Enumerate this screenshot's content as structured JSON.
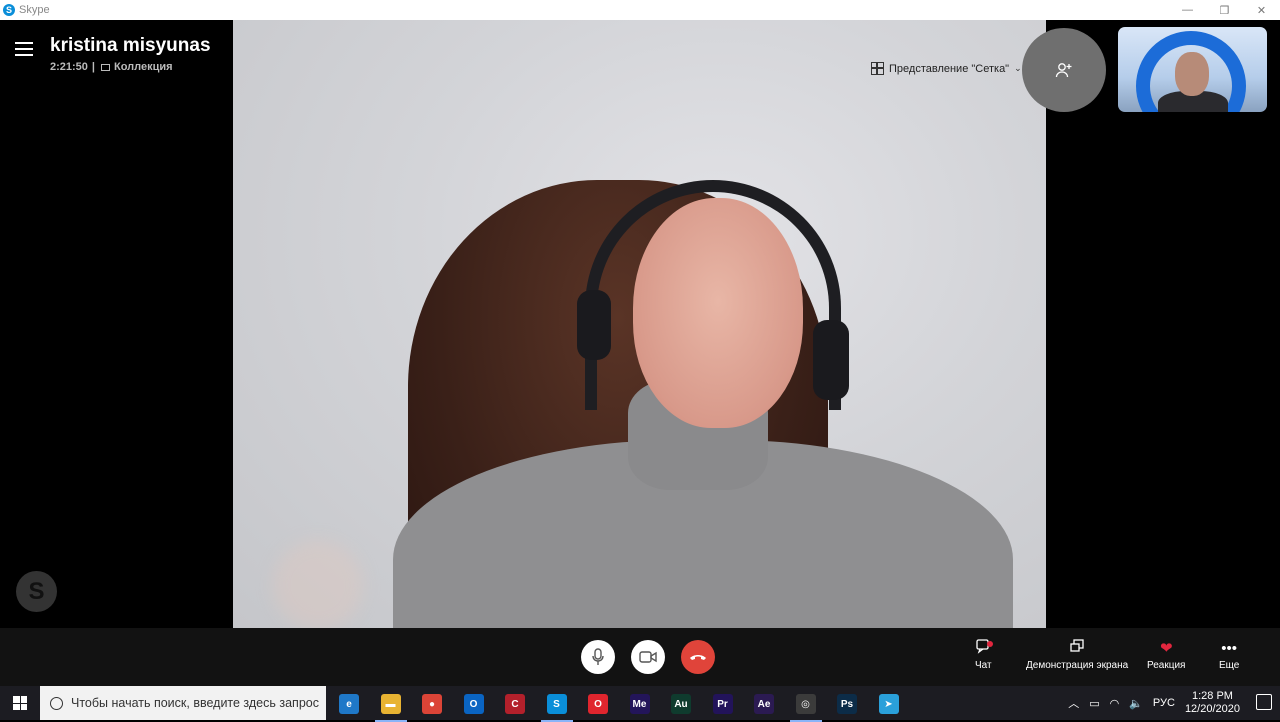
{
  "window": {
    "title": "Skype",
    "minimize": "—",
    "restore": "❐",
    "close": "✕"
  },
  "call": {
    "contact_name": "kristina misyunas",
    "duration": "2:21:50",
    "separator": "|",
    "gallery_label": "Коллекция",
    "view_label": "Представление \"Сетка\"",
    "add_people_icon": "add-person-icon"
  },
  "controls": {
    "chat_label": "Чат",
    "share_label": "Демонстрация экрана",
    "reaction_label": "Реакция",
    "more_label": "Еще"
  },
  "taskbar": {
    "search_placeholder": "Чтобы начать поиск, введите здесь запрос",
    "apps": [
      {
        "name": "edge",
        "label": "e",
        "color": "#1f78c8"
      },
      {
        "name": "file-explorer",
        "label": "▬",
        "color": "#e8b332"
      },
      {
        "name": "chrome",
        "label": "●",
        "color": "#db4437"
      },
      {
        "name": "outlook",
        "label": "O",
        "color": "#0a64c2"
      },
      {
        "name": "app-red",
        "label": "C",
        "color": "#b3202b"
      },
      {
        "name": "skype",
        "label": "S",
        "color": "#0a8ed9"
      },
      {
        "name": "opera",
        "label": "O",
        "color": "#e0252e"
      },
      {
        "name": "media-encoder",
        "label": "Me",
        "color": "#23155a"
      },
      {
        "name": "audition",
        "label": "Au",
        "color": "#0f3b2e"
      },
      {
        "name": "premiere",
        "label": "Pr",
        "color": "#22135a"
      },
      {
        "name": "after-effects",
        "label": "Ae",
        "color": "#2b1a52"
      },
      {
        "name": "obs",
        "label": "◎",
        "color": "#3b3b3b"
      },
      {
        "name": "photoshop",
        "label": "Ps",
        "color": "#0c2c48"
      },
      {
        "name": "telegram",
        "label": "➤",
        "color": "#2aa0da"
      }
    ],
    "language": "РУС",
    "time": "1:28 PM",
    "date": "12/20/2020"
  }
}
